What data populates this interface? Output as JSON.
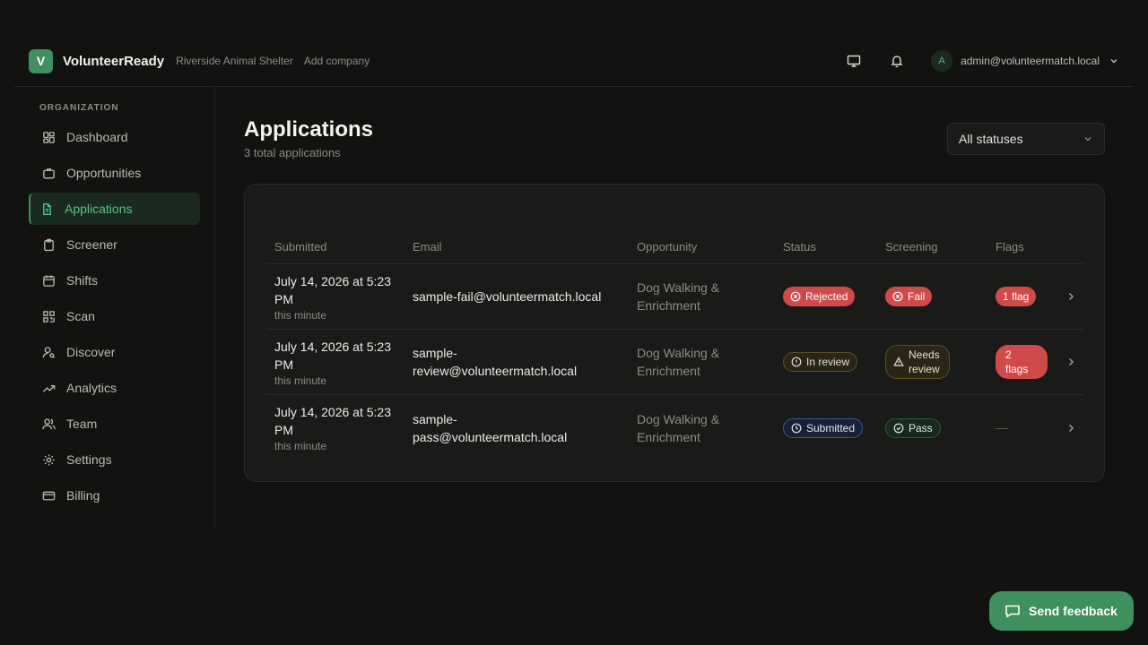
{
  "header": {
    "logo_letter": "V",
    "app_name": "VolunteerReady",
    "org_name": "Riverside Animal Shelter",
    "add_company": "Add company",
    "user_initial": "A",
    "user_email": "admin@volunteermatch.local"
  },
  "sidebar": {
    "heading": "ORGANIZATION",
    "items": [
      {
        "label": "Dashboard",
        "icon": "dashboard-icon"
      },
      {
        "label": "Opportunities",
        "icon": "briefcase-icon"
      },
      {
        "label": "Applications",
        "icon": "file-icon",
        "active": true
      },
      {
        "label": "Screener",
        "icon": "clipboard-icon"
      },
      {
        "label": "Shifts",
        "icon": "calendar-icon"
      },
      {
        "label": "Scan",
        "icon": "qr-code-icon"
      },
      {
        "label": "Discover",
        "icon": "user-search-icon"
      },
      {
        "label": "Analytics",
        "icon": "trend-icon"
      },
      {
        "label": "Team",
        "icon": "users-icon"
      },
      {
        "label": "Settings",
        "icon": "gear-icon"
      },
      {
        "label": "Billing",
        "icon": "credit-card-icon"
      }
    ]
  },
  "main": {
    "title": "Applications",
    "subtitle": "3 total applications",
    "filter_value": "All statuses",
    "table": {
      "columns": [
        "Submitted",
        "Email",
        "Opportunity",
        "Status",
        "Screening",
        "Flags"
      ],
      "rows": [
        {
          "date_line1": "July 14, 2026 at 5:23",
          "date_line2": "PM",
          "relative": "this minute",
          "email_line1": "sample-fail@volunteermatch.local",
          "email_line2": "",
          "opp_line1": "Dog Walking &",
          "opp_line2": "Enrichment",
          "status": "Rejected",
          "screening_line1": "Fail",
          "screening_line2": "",
          "flags_line1": "1 flag",
          "flags_line2": ""
        },
        {
          "date_line1": "July 14, 2026 at 5:23",
          "date_line2": "PM",
          "relative": "this minute",
          "email_line1": "sample-",
          "email_line2": "review@volunteermatch.local",
          "opp_line1": "Dog Walking &",
          "opp_line2": "Enrichment",
          "status": "In review",
          "screening_line1": "Needs",
          "screening_line2": "review",
          "flags_line1": "2",
          "flags_line2": "flags"
        },
        {
          "date_line1": "July 14, 2026 at 5:23",
          "date_line2": "PM",
          "relative": "this minute",
          "email_line1": "sample-",
          "email_line2": "pass@volunteermatch.local",
          "opp_line1": "Dog Walking &",
          "opp_line2": "Enrichment",
          "status": "Submitted",
          "screening_line1": "Pass",
          "screening_line2": "",
          "flags_line1": "—",
          "flags_line2": ""
        }
      ]
    }
  },
  "feedback": {
    "label": "Send feedback"
  },
  "colors": {
    "accent": "#3f8f5f",
    "rejected": "#d04a4a",
    "in_review": "#5e4e24",
    "submitted": "#3c5a88",
    "pass": "#2d5a3c"
  }
}
